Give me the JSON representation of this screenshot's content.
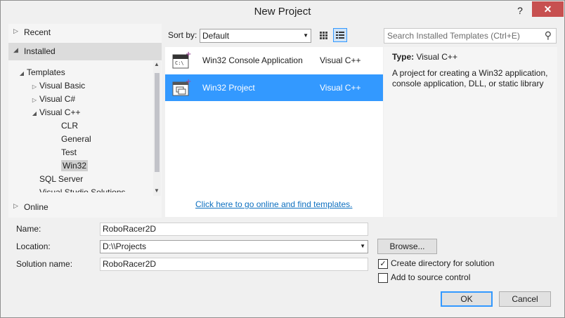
{
  "window": {
    "title": "New Project",
    "help": "?",
    "close": "✕"
  },
  "nav": {
    "recent": "Recent",
    "installed": "Installed",
    "online": "Online",
    "tree": [
      {
        "label": "Templates",
        "twisty": "◢",
        "indent": 0
      },
      {
        "label": "Visual Basic",
        "twisty": "▷",
        "indent": 1
      },
      {
        "label": "Visual C#",
        "twisty": "▷",
        "indent": 1
      },
      {
        "label": "Visual C++",
        "twisty": "◢",
        "indent": 1
      },
      {
        "label": "CLR",
        "twisty": "",
        "indent": 2
      },
      {
        "label": "General",
        "twisty": "",
        "indent": 2
      },
      {
        "label": "Test",
        "twisty": "",
        "indent": 2
      },
      {
        "label": "Win32",
        "twisty": "",
        "indent": 2,
        "selected": true
      },
      {
        "label": "SQL Server",
        "twisty": "",
        "indent": 1
      },
      {
        "label": "Visual Studio Solutions",
        "twisty": "",
        "indent": 1
      }
    ]
  },
  "toolbar": {
    "sort_label": "Sort by:",
    "sort_value": "Default",
    "search_placeholder": "Search Installed Templates (Ctrl+E)"
  },
  "templates": [
    {
      "name": "Win32 Console Application",
      "lang": "Visual C++",
      "selected": false
    },
    {
      "name": "Win32 Project",
      "lang": "Visual C++",
      "selected": true
    }
  ],
  "online_link": "Click here to go online and find templates.",
  "description": {
    "type_label": "Type:",
    "type_value": "Visual C++",
    "text": "A project for creating a Win32 application, console application, DLL, or static library"
  },
  "form": {
    "name_label": "Name:",
    "name_value": "RoboRacer2D",
    "location_label": "Location:",
    "location_value": "D:\\\\Projects",
    "solution_label": "Solution name:",
    "solution_value": "RoboRacer2D",
    "browse": "Browse...",
    "create_dir": {
      "label": "Create directory for solution",
      "checked": true
    },
    "source_control": {
      "label": "Add to source control",
      "checked": false
    },
    "ok": "OK",
    "cancel": "Cancel"
  },
  "colors": {
    "selection": "#3399ff",
    "link": "#0e70c0",
    "close": "#c75050"
  }
}
